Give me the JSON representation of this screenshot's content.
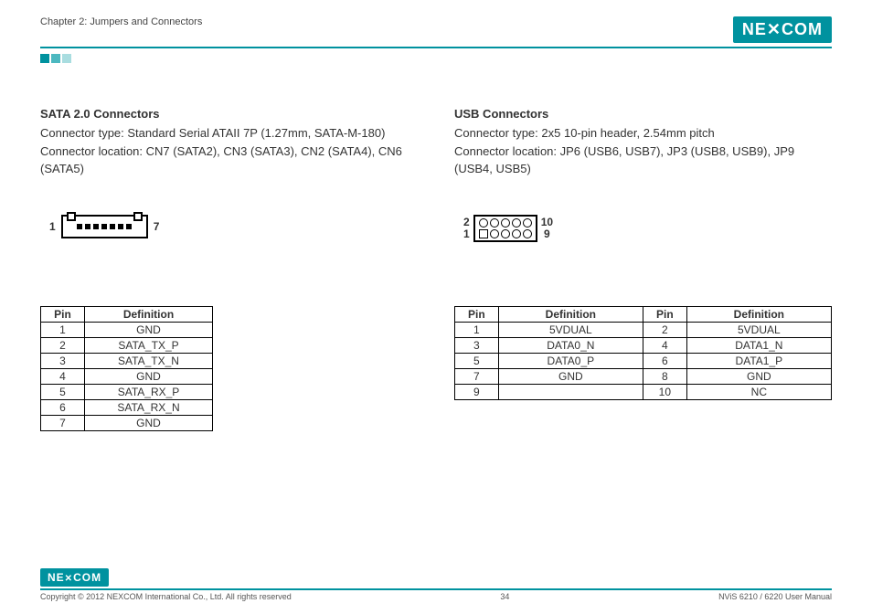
{
  "header": {
    "chapter": "Chapter 2: Jumpers and Connectors",
    "logo": "NE COM"
  },
  "left": {
    "title": "SATA 2.0 Connectors",
    "line1": "Connector type: Standard Serial ATAII 7P (1.27mm, SATA-M-180)",
    "line2": "Connector location: CN7 (SATA2), CN3 (SATA3), CN2 (SATA4), CN6 (SATA5)",
    "diag_left": "1",
    "diag_right": "7",
    "th_pin": "Pin",
    "th_def": "Definition",
    "rows": [
      {
        "pin": "1",
        "def": "GND"
      },
      {
        "pin": "2",
        "def": "SATA_TX_P"
      },
      {
        "pin": "3",
        "def": "SATA_TX_N"
      },
      {
        "pin": "4",
        "def": "GND"
      },
      {
        "pin": "5",
        "def": "SATA_RX_P"
      },
      {
        "pin": "6",
        "def": "SATA_RX_N"
      },
      {
        "pin": "7",
        "def": "GND"
      }
    ]
  },
  "right": {
    "title": "USB Connectors",
    "line1": "Connector type: 2x5 10-pin header, 2.54mm pitch",
    "line2": "Connector location: JP6 (USB6, USB7), JP3 (USB8, USB9), JP9 (USB4, USB5)",
    "diag_tl": "2",
    "diag_bl": "1",
    "diag_tr": "10",
    "diag_br": "9",
    "th_pin": "Pin",
    "th_def": "Definition",
    "rows": [
      {
        "p1": "1",
        "d1": "5VDUAL",
        "p2": "2",
        "d2": "5VDUAL"
      },
      {
        "p1": "3",
        "d1": "DATA0_N",
        "p2": "4",
        "d2": "DATA1_N"
      },
      {
        "p1": "5",
        "d1": "DATA0_P",
        "p2": "6",
        "d2": "DATA1_P"
      },
      {
        "p1": "7",
        "d1": "GND",
        "p2": "8",
        "d2": "GND"
      },
      {
        "p1": "9",
        "d1": "",
        "p2": "10",
        "d2": "NC"
      }
    ]
  },
  "footer": {
    "logo": "NE COM",
    "copyright": "Copyright © 2012 NEXCOM International Co., Ltd. All rights reserved",
    "page": "34",
    "manual": "NViS 6210 / 6220 User Manual"
  }
}
